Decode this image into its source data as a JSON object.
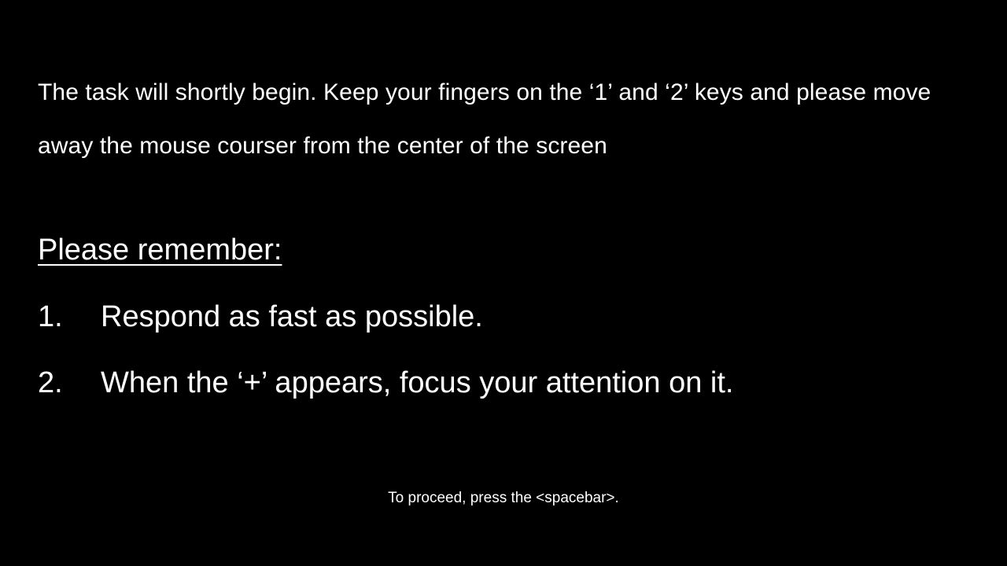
{
  "instructions": {
    "intro_text": "The task will shortly begin. Keep your fingers on the ‘1’ and ‘2’ keys and please move away the mouse courser from the center of the screen",
    "reminder_heading": "Please remember:",
    "rules": [
      {
        "number": "1.",
        "text": "Respond as fast as possible."
      },
      {
        "number": "2.",
        "text": "When the ‘+’ appears, focus your attention on it."
      }
    ],
    "proceed_prompt": "To proceed, press the <spacebar>."
  },
  "colors": {
    "background": "#000000",
    "text": "#ffffff"
  }
}
